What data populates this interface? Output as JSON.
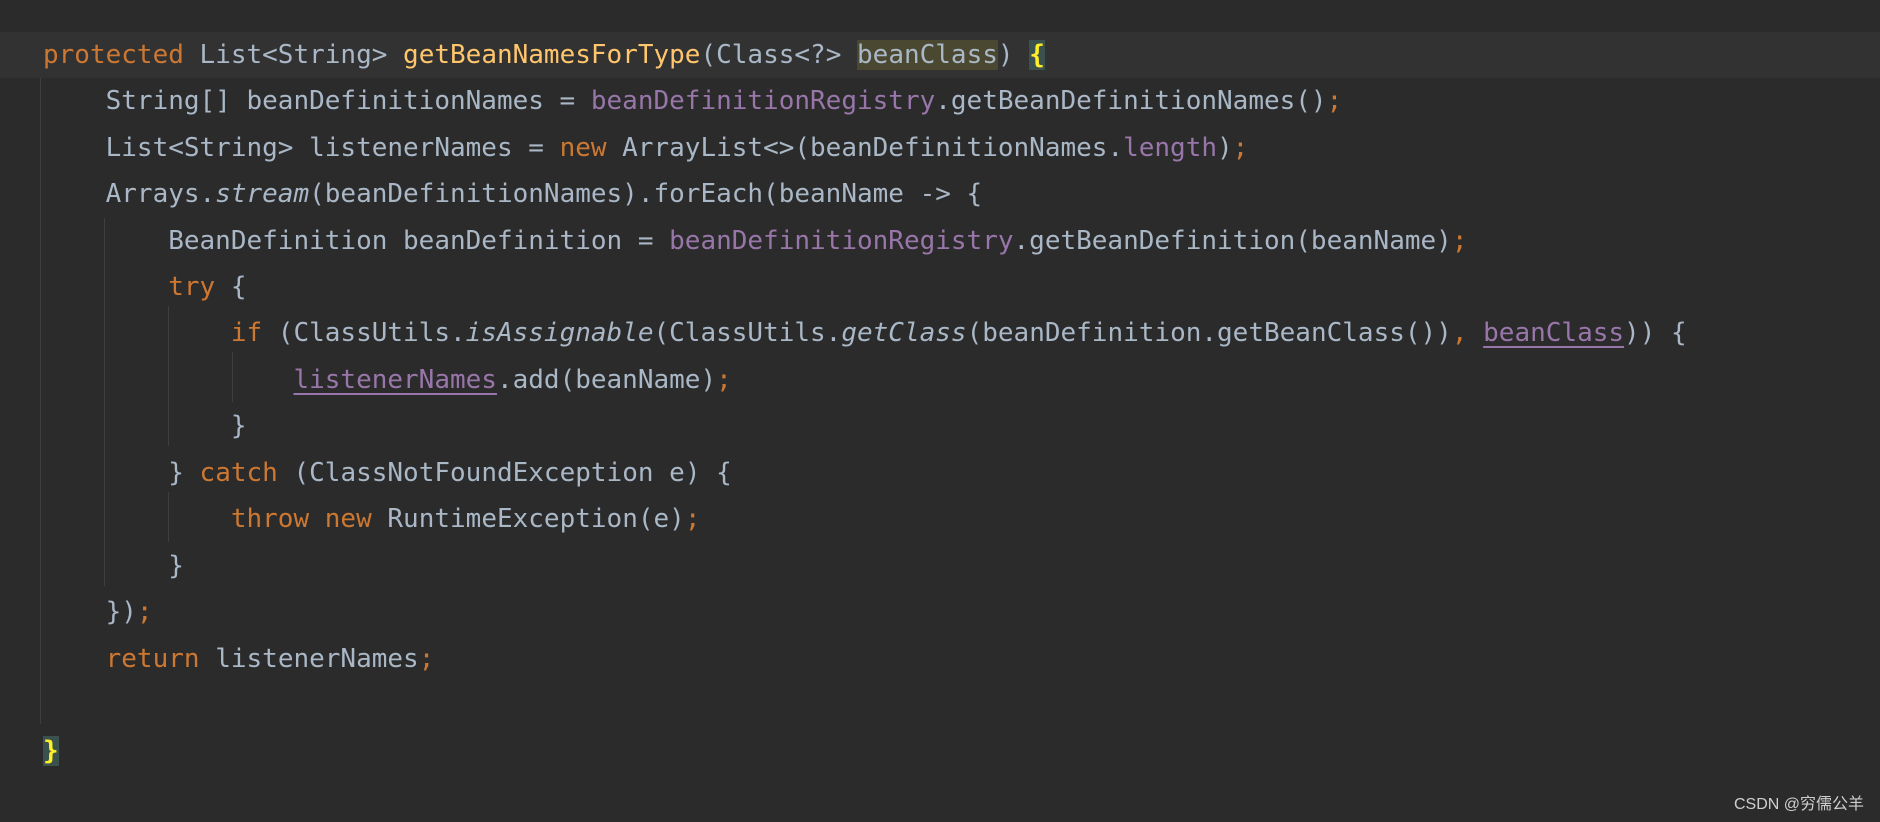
{
  "editor": {
    "lines": [
      {
        "tokens": [
          {
            "t": "protected",
            "c": "kw"
          },
          {
            "t": " List<String> ",
            "c": ""
          },
          {
            "t": "getBeanNamesForType",
            "c": "fn"
          },
          {
            "t": "(Class<?> ",
            "c": ""
          },
          {
            "t": "beanClass",
            "c": "param-hl"
          },
          {
            "t": ") ",
            "c": ""
          },
          {
            "t": "{",
            "c": "brace-hl"
          }
        ]
      },
      {
        "tokens": [
          {
            "t": "    String[] beanDefinitionNames = ",
            "c": ""
          },
          {
            "t": "beanDefinitionRegistry",
            "c": "field"
          },
          {
            "t": ".getBeanDefinitionNames()",
            "c": ""
          },
          {
            "t": ";",
            "c": "semi"
          }
        ]
      },
      {
        "tokens": [
          {
            "t": "    List<String> listenerNames = ",
            "c": ""
          },
          {
            "t": "new",
            "c": "kw"
          },
          {
            "t": " ArrayList<>(beanDefinitionNames.",
            "c": ""
          },
          {
            "t": "length",
            "c": "field"
          },
          {
            "t": ")",
            "c": ""
          },
          {
            "t": ";",
            "c": "semi"
          }
        ]
      },
      {
        "tokens": [
          {
            "t": "    Arrays.",
            "c": ""
          },
          {
            "t": "stream",
            "c": "it"
          },
          {
            "t": "(beanDefinitionNames).forEach(beanName -> {",
            "c": ""
          }
        ]
      },
      {
        "tokens": [
          {
            "t": "        BeanDefinition beanDefinition = ",
            "c": ""
          },
          {
            "t": "beanDefinitionRegistry",
            "c": "field"
          },
          {
            "t": ".getBeanDefinition(beanName)",
            "c": ""
          },
          {
            "t": ";",
            "c": "semi"
          }
        ]
      },
      {
        "tokens": [
          {
            "t": "        ",
            "c": ""
          },
          {
            "t": "try",
            "c": "kw"
          },
          {
            "t": " {",
            "c": ""
          }
        ]
      },
      {
        "tokens": [
          {
            "t": "            ",
            "c": ""
          },
          {
            "t": "if",
            "c": "kw"
          },
          {
            "t": " (ClassUtils.",
            "c": ""
          },
          {
            "t": "isAssignable",
            "c": "it"
          },
          {
            "t": "(ClassUtils.",
            "c": ""
          },
          {
            "t": "getClass",
            "c": "it"
          },
          {
            "t": "(beanDefinition.getBeanClass())",
            "c": ""
          },
          {
            "t": ",",
            "c": "semi"
          },
          {
            "t": " ",
            "c": ""
          },
          {
            "t": "beanClass",
            "c": "field ul"
          },
          {
            "t": ")) {",
            "c": ""
          }
        ]
      },
      {
        "tokens": [
          {
            "t": "                ",
            "c": ""
          },
          {
            "t": "listenerNames",
            "c": "field ul"
          },
          {
            "t": ".add(beanName)",
            "c": ""
          },
          {
            "t": ";",
            "c": "semi"
          }
        ]
      },
      {
        "tokens": [
          {
            "t": "            }",
            "c": ""
          }
        ]
      },
      {
        "tokens": [
          {
            "t": "        } ",
            "c": ""
          },
          {
            "t": "catch",
            "c": "kw"
          },
          {
            "t": " (ClassNotFoundException e) {",
            "c": ""
          }
        ]
      },
      {
        "tokens": [
          {
            "t": "            ",
            "c": ""
          },
          {
            "t": "throw",
            "c": "kw"
          },
          {
            "t": " ",
            "c": ""
          },
          {
            "t": "new",
            "c": "kw"
          },
          {
            "t": " RuntimeException(e)",
            "c": ""
          },
          {
            "t": ";",
            "c": "semi"
          }
        ]
      },
      {
        "tokens": [
          {
            "t": "        }",
            "c": ""
          }
        ]
      },
      {
        "tokens": [
          {
            "t": "    })",
            "c": ""
          },
          {
            "t": ";",
            "c": "semi"
          }
        ]
      },
      {
        "tokens": [
          {
            "t": "    ",
            "c": ""
          },
          {
            "t": "return",
            "c": "kw"
          },
          {
            "t": " listenerNames",
            "c": ""
          },
          {
            "t": ";",
            "c": "semi"
          }
        ]
      },
      {
        "tokens": []
      },
      {
        "tokens": [
          {
            "t": "}",
            "c": "brace-hl"
          }
        ]
      }
    ]
  },
  "watermark": "CSDN @穷儒公羊",
  "colors": {
    "background": "#2b2b2b",
    "keyword": "#cc7832",
    "function": "#ffc66d",
    "field": "#9876aa",
    "text": "#a9b7c6"
  }
}
